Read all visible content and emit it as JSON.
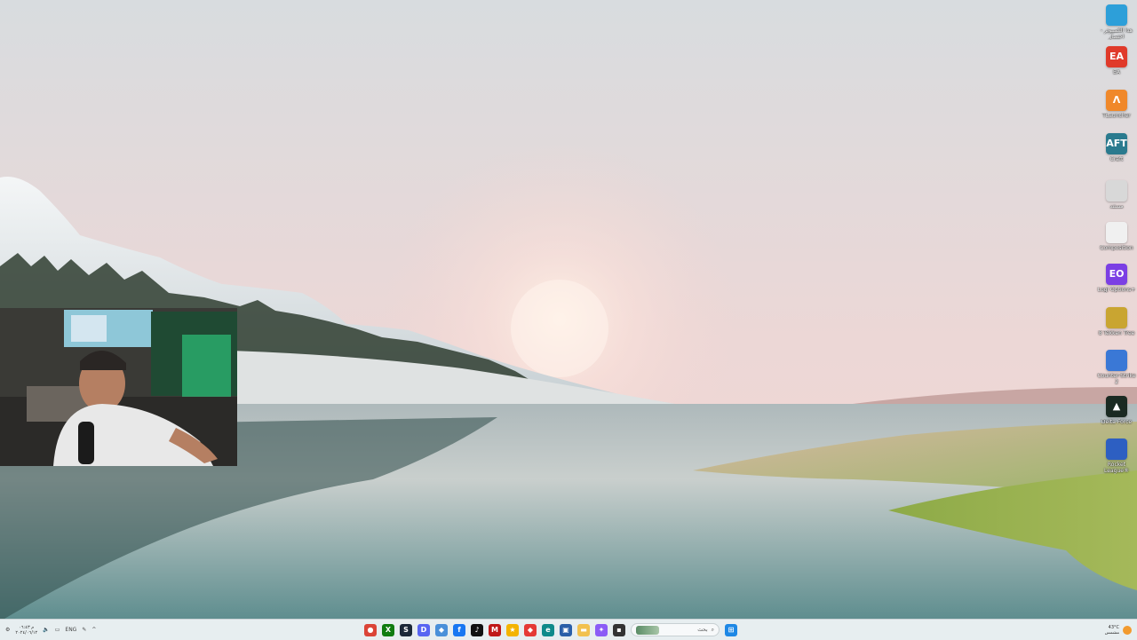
{
  "desktop_icons": [
    {
      "id": "this-pc",
      "label": "هذا الكمبيوتر - اختصار",
      "icon": "monitor-icon",
      "color": "#2d9fd9"
    },
    {
      "id": "ea",
      "label": "EA",
      "icon": "ea-icon",
      "color": "#e03a2a",
      "glyph": "EA"
    },
    {
      "id": "tlauncher",
      "label": "TLauncher",
      "icon": "tlauncher-icon",
      "color": "#f0882a",
      "glyph": "Λ"
    },
    {
      "id": "craft",
      "label": "Craft",
      "icon": "craft-icon",
      "color": "#2a7a8e",
      "glyph": "AFT"
    },
    {
      "id": "file1",
      "label": "مستند",
      "icon": "document-icon",
      "color": "#d8d8d8"
    },
    {
      "id": "file2",
      "label": "Composition",
      "icon": "file-icon",
      "color": "#f0f0f0"
    },
    {
      "id": "eo",
      "label": "Logi Options+",
      "icon": "eo-icon",
      "color": "#7b3fe4",
      "glyph": "EO"
    },
    {
      "id": "game1",
      "label": "8 Tekken Tree",
      "icon": "game-icon",
      "color": "#c9a531"
    },
    {
      "id": "game2",
      "label": "Counter-Strike 2",
      "icon": "cs-icon",
      "color": "#3a78d6"
    },
    {
      "id": "delta",
      "label": "Delta Force",
      "icon": "delta-force-icon",
      "color": "#1a2a22",
      "glyph": "▲"
    },
    {
      "id": "rocket",
      "label": "Rocket League®",
      "icon": "rocket-league-icon",
      "color": "#2d5fc2"
    }
  ],
  "taskbar": {
    "clock_time": "م ٠٦:٤٣",
    "clock_date": "٢٠٢٤/٠٦/١٢",
    "language": "ENG",
    "search_placeholder": "بحث",
    "weather_temp": "43°C",
    "weather_text": "مشمس",
    "apps": [
      {
        "name": "chrome-icon",
        "color": "#db4437",
        "glyph": "●"
      },
      {
        "name": "xbox-icon",
        "color": "#107c10",
        "glyph": "X"
      },
      {
        "name": "steam-icon",
        "color": "#1b2838",
        "glyph": "S"
      },
      {
        "name": "discord-icon",
        "color": "#5865f2",
        "glyph": "D"
      },
      {
        "name": "shield-icon",
        "color": "#4a90d9",
        "glyph": "◆"
      },
      {
        "name": "facebook-icon",
        "color": "#1877f2",
        "glyph": "f"
      },
      {
        "name": "tiktok-icon",
        "color": "#111111",
        "glyph": "♪"
      },
      {
        "name": "mcafee-icon",
        "color": "#c01818",
        "glyph": "M"
      },
      {
        "name": "colorful-app-icon",
        "color": "#f4b400",
        "glyph": "★"
      },
      {
        "name": "red-diamond-icon",
        "color": "#e53935",
        "glyph": "◆"
      },
      {
        "name": "edge-icon",
        "color": "#0f8a8a",
        "glyph": "e"
      },
      {
        "name": "store-icon",
        "color": "#2a5fa8",
        "glyph": "▣"
      },
      {
        "name": "file-explorer-icon",
        "color": "#f2c14e",
        "glyph": "▬"
      },
      {
        "name": "copilot-icon",
        "color": "#8b5cf6",
        "glyph": "✦"
      },
      {
        "name": "terminal-icon",
        "color": "#333333",
        "glyph": "▪"
      }
    ]
  }
}
